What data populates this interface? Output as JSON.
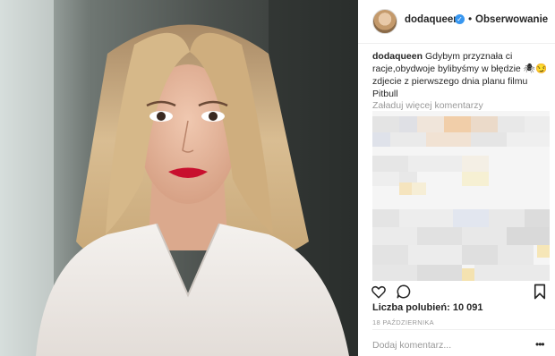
{
  "post": {
    "username": "dodaqueen",
    "follow_label": "Obserwowanie",
    "caption_user": "dodaqueen",
    "caption_text": "Gdybym przyznała ci racje,obydwoje bylibyśmy w błędzie 🕷😏 zdjecie z pierwszego dnia planu filmu Pitbull",
    "load_more": "Załaduj więcej komentarzy",
    "likes": "Liczba polubień: 10 091",
    "date": "18 PAŹDZIERNIKA",
    "comment_placeholder": "Dodaj komentarz...",
    "more_icon": "•••"
  },
  "icons": [
    "heart-icon",
    "comment-icon",
    "bookmark-icon",
    "verified-icon",
    "more-icon"
  ],
  "colors": {
    "verified": "#3897f0",
    "muted": "#999999",
    "text": "#262626"
  }
}
